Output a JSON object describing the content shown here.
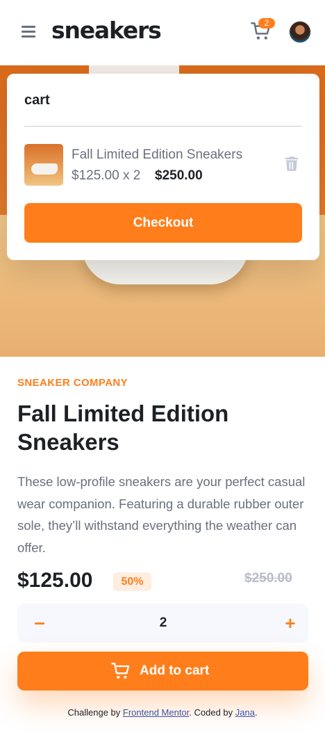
{
  "header": {
    "logo": "sneakers",
    "cart_count": "2"
  },
  "cart": {
    "title": "cart",
    "item": {
      "name": "Fall Limited Edition Sneakers",
      "price_qty": "$125.00 x  2",
      "total": "$250.00"
    },
    "checkout_label": "Checkout"
  },
  "product": {
    "company": "SNEAKER COMPANY",
    "title": "Fall Limited Edition Sneakers",
    "description": "These low-profile sneakers are your perfect casual wear companion. Featuring a durable rubber outer sole, they’ll withstand everything the weather can offer.",
    "price": "$125.00",
    "discount": "50%",
    "old_price": "$250.00"
  },
  "quantity": {
    "minus": "–",
    "value": "2",
    "plus": "+"
  },
  "add_to_cart_label": "Add to cart",
  "attribution": {
    "prefix": "Challenge by ",
    "link1": "Frontend Mentor",
    "middle": ". Coded by ",
    "link2": "Jana",
    "suffix": "."
  },
  "colors": {
    "accent": "#ff7e1b",
    "accent_pale": "#ffede0",
    "text_dark": "#1d2025",
    "text_muted": "#69707d",
    "strike_gray": "#b6bcc8"
  },
  "icons": [
    "menu-icon",
    "cart-icon",
    "avatar",
    "trash-icon",
    "minus-icon",
    "plus-icon"
  ]
}
